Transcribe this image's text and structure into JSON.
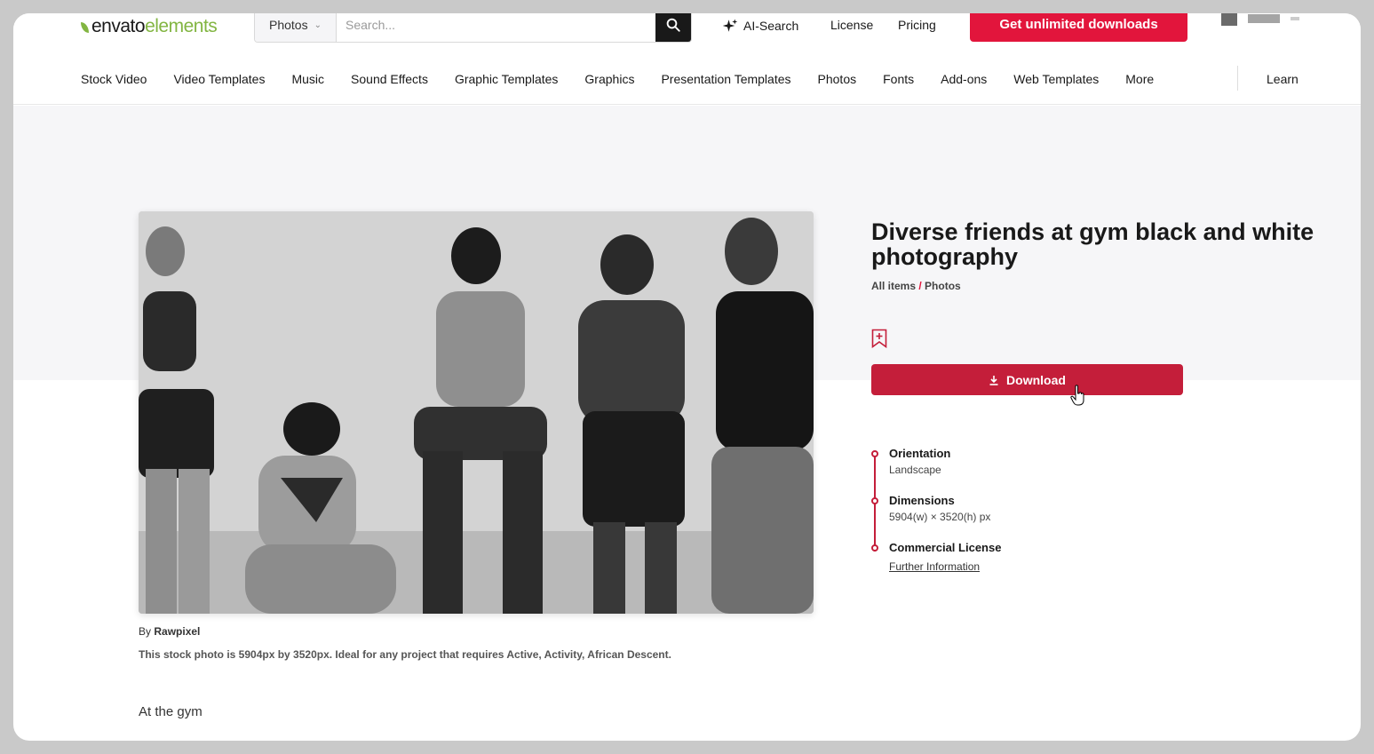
{
  "header": {
    "logo_part1": "envato",
    "logo_part2": "elements",
    "search_category": "Photos",
    "search_placeholder": "Search...",
    "ai_search": "AI-Search",
    "license": "License",
    "pricing": "Pricing",
    "cta": "Get unlimited downloads"
  },
  "categories": [
    "Stock Video",
    "Video Templates",
    "Music",
    "Sound Effects",
    "Graphic Templates",
    "Graphics",
    "Presentation Templates",
    "Photos",
    "Fonts",
    "Add-ons",
    "Web Templates",
    "More"
  ],
  "learn": "Learn",
  "item": {
    "title": "Diverse friends at gym black and white photography",
    "breadcrumb_all": "All items",
    "breadcrumb_sep": "/",
    "breadcrumb_cat": "Photos",
    "download_label": "Download",
    "by_label": "By",
    "author": "Rawpixel",
    "description": "This stock photo is 5904px by 3520px. Ideal for any project that requires Active, Activity, African Descent.",
    "subtitle": "At the gym"
  },
  "meta": {
    "orientation_label": "Orientation",
    "orientation_value": "Landscape",
    "dimensions_label": "Dimensions",
    "dimensions_value": "5904(w) × 3520(h) px",
    "license_label": "Commercial License",
    "license_link": "Further Information"
  },
  "colors": {
    "brand_green": "#82b541",
    "cta_red": "#e2153c",
    "download_red": "#c41e3a"
  }
}
